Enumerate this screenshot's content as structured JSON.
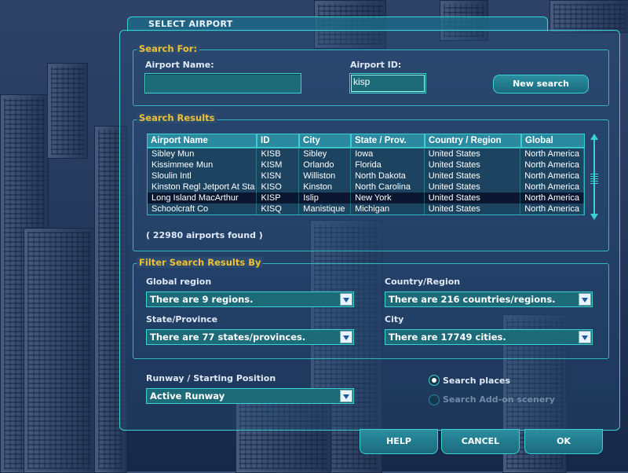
{
  "dialog": {
    "title": "SELECT AIRPORT"
  },
  "search_for": {
    "group_label": "Search For:",
    "airport_name_label": "Airport Name:",
    "airport_name_value": "",
    "airport_id_label": "Airport ID:",
    "airport_id_value": "kisp",
    "new_search_button": "New search"
  },
  "results": {
    "group_label": "Search Results",
    "columns": [
      "Airport Name",
      "ID",
      "City",
      "State / Prov.",
      "Country / Region",
      "Global"
    ],
    "rows": [
      [
        "Sibley Mun",
        "KISB",
        "Sibley",
        "Iowa",
        "United States",
        "North America"
      ],
      [
        "Kissimmee Mun",
        "KISM",
        "Orlando",
        "Florida",
        "United States",
        "North America"
      ],
      [
        "Sloulin Intl",
        "KISN",
        "Williston",
        "North Dakota",
        "United States",
        "North America"
      ],
      [
        "Kinston Regl Jetport At Sta",
        "KISO",
        "Kinston",
        "North Carolina",
        "United States",
        "North America"
      ],
      [
        "Long Island MacArthur",
        "KISP",
        "Islip",
        "New York",
        "United States",
        "North America"
      ],
      [
        "Schoolcraft Co",
        "KISQ",
        "Manistique",
        "Michigan",
        "United States",
        "North America"
      ]
    ],
    "selected_index": 4,
    "count_text": "( 22980 airports found )"
  },
  "filter": {
    "group_label": "Filter Search Results By",
    "global_region_label": "Global region",
    "global_region_value": "There are 9 regions.",
    "country_label": "Country/Region",
    "country_value": "There are 216 countries/regions.",
    "state_label": "State/Province",
    "state_value": "There are 77 states/provinces.",
    "city_label": "City",
    "city_value": "There are 17749 cities."
  },
  "runway": {
    "label": "Runway / Starting Position",
    "value": "Active Runway"
  },
  "options": {
    "search_places": "Search places",
    "search_addon": "Search Add-on scenery"
  },
  "buttons": {
    "help": "HELP",
    "cancel": "CANCEL",
    "ok": "OK"
  },
  "colors": {
    "accent": "#39d3d3",
    "label": "#f0c030",
    "field": "#1d6a78"
  }
}
